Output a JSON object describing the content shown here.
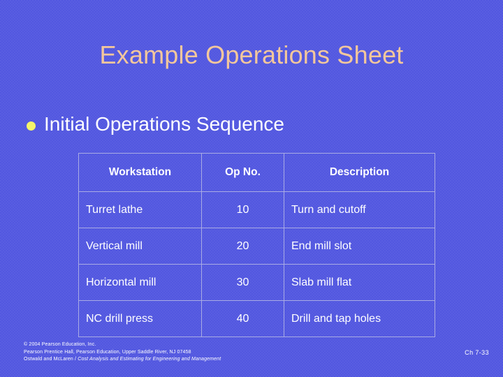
{
  "slide": {
    "title": "Example Operations Sheet",
    "background_color": "#5257e0",
    "title_color": "#f3c79c",
    "body_text_color": "#ffffff",
    "bullet_color": "#f4f46a",
    "table_border_color": "#a9abe4"
  },
  "bullet": {
    "marker": "filled-circle-bullet",
    "label": "Initial Operations Sequence"
  },
  "table": {
    "headers": [
      "Workstation",
      "Op No.",
      "Description"
    ],
    "rows": [
      {
        "workstation": "Turret lathe",
        "op_no": "10",
        "description": "Turn and cutoff"
      },
      {
        "workstation": "Vertical mill",
        "op_no": "20",
        "description": "End mill slot"
      },
      {
        "workstation": "Horizontal mill",
        "op_no": "30",
        "description": "Slab mill flat"
      },
      {
        "workstation": "NC drill press",
        "op_no": "40",
        "description": "Drill and tap holes"
      }
    ]
  },
  "footer": {
    "line1": "© 2004 Pearson Education, Inc.",
    "line2": "Pearson Prentice Hall, Pearson Education, Upper Saddle River, NJ 07458",
    "line3_plain": "Ostwald and McLaren / ",
    "line3_italic": "Cost Analysis and Estimating for Engineering and Management",
    "page_marker": "Ch 7-33"
  }
}
